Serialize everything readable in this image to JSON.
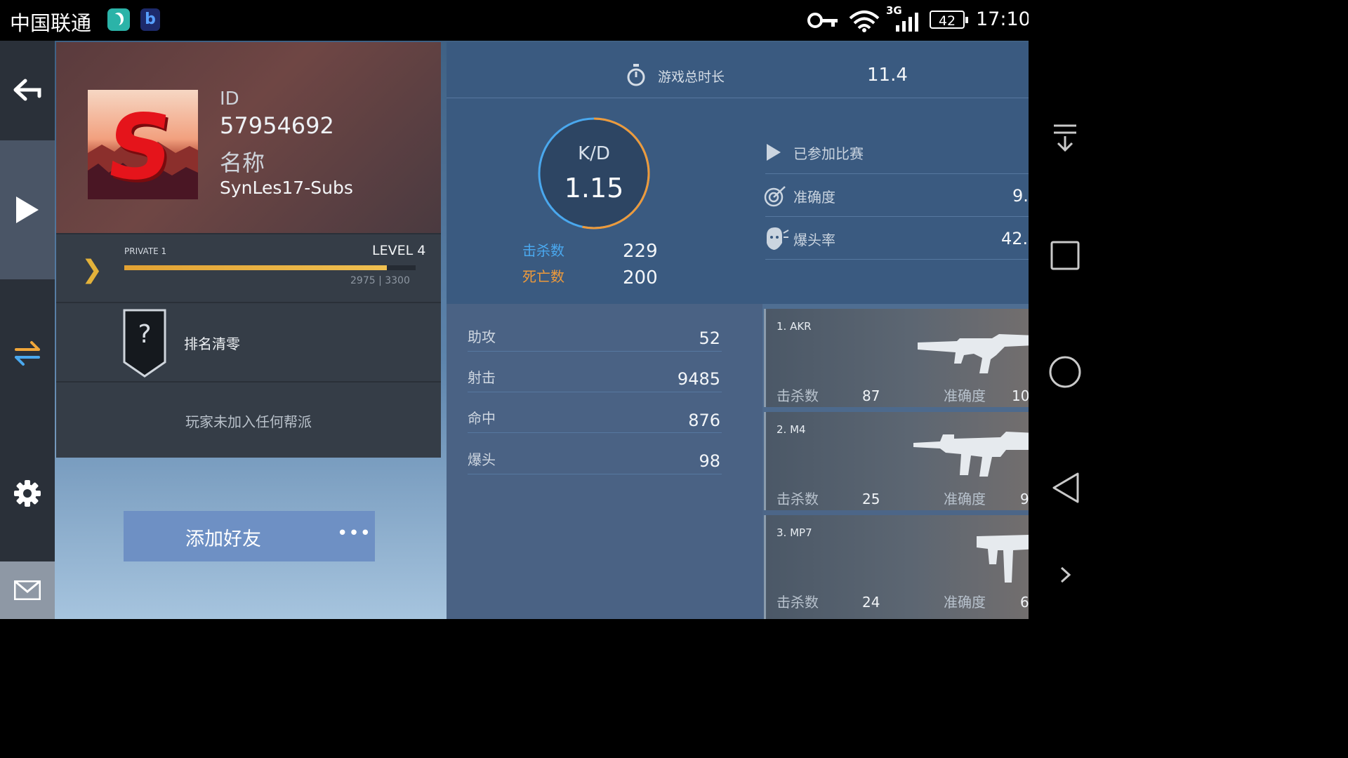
{
  "status_bar": {
    "carrier": "中国联通",
    "network": "3G",
    "battery": "42",
    "time": "17:10"
  },
  "profile": {
    "id_label": "ID",
    "id_value": "57954692",
    "name_label": "名称",
    "name_value": "SynLes17-Subs",
    "rank": "PRIVATE 1",
    "level": "LEVEL 4",
    "xp": "2975 | 3300",
    "xp_progress": 0.9,
    "rank_reset": "排名清零",
    "rank_icon": "?",
    "clan_status": "玩家未加入任何帮派",
    "add_friend": "添加好友",
    "more": "•••"
  },
  "stats": {
    "playtime_label": "游戏总时长",
    "playtime_value": "11.4",
    "kd_label": "K/D",
    "kd_value": "1.15",
    "kills_label": "击杀数",
    "kills_value": "229",
    "deaths_label": "死亡数",
    "deaths_value": "200",
    "matches_label": "已参加比赛",
    "accuracy_label": "准确度",
    "accuracy_value": "9.",
    "headshot_rate_label": "爆头率",
    "headshot_rate_value": "42.",
    "assists_label": "助攻",
    "assists_value": "52",
    "shots_label": "射击",
    "shots_value": "9485",
    "hits_label": "命中",
    "hits_value": "876",
    "headshots_label": "爆头",
    "headshots_value": "98"
  },
  "weapons": [
    {
      "name": "1. AKR",
      "kills_label": "击杀数",
      "kills": "87",
      "acc_label": "准确度",
      "acc": "10"
    },
    {
      "name": "2. M4",
      "kills_label": "击杀数",
      "kills": "25",
      "acc_label": "准确度",
      "acc": "9"
    },
    {
      "name": "3. MP7",
      "kills_label": "击杀数",
      "kills": "24",
      "acc_label": "准确度",
      "acc": "6"
    }
  ],
  "colors": {
    "accent_gold": "#e3b23a",
    "kills_blue": "#4aa8ee",
    "deaths_orange": "#ee9a3a"
  }
}
